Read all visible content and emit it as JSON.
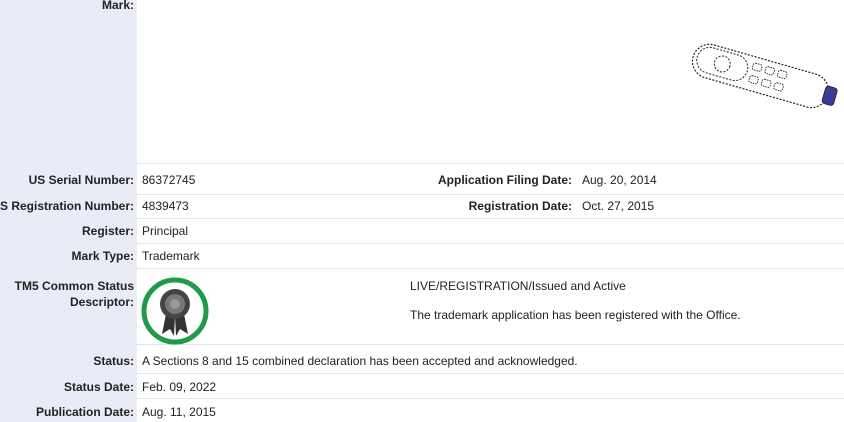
{
  "mark": {
    "label": "Mark:",
    "icon": "mark-drawing-remote"
  },
  "serial": {
    "label": "US Serial Number:",
    "value": "86372745"
  },
  "filing": {
    "label": "Application Filing Date:",
    "value": "Aug. 20, 2014"
  },
  "registration_number": {
    "label": "US Registration Number:",
    "value": "4839473"
  },
  "registration_date": {
    "label": "Registration Date:",
    "value": "Oct. 27, 2015"
  },
  "register": {
    "label": "Register:",
    "value": "Principal"
  },
  "mark_type": {
    "label": "Mark Type:",
    "value": "Trademark"
  },
  "tm5": {
    "label_line1": "TM5 Common Status",
    "label_line2": "Descriptor:",
    "status_code": "LIVE/REGISTRATION/Issued and Active",
    "status_desc": "The trademark application has been registered with the Office.",
    "badge_color": "#1f9a48"
  },
  "status": {
    "label": "Status:",
    "value": "A Sections 8 and 15 combined declaration has been accepted and acknowledged."
  },
  "status_date": {
    "label": "Status Date:",
    "value": "Feb. 09, 2022"
  },
  "publication_date": {
    "label": "Publication Date:",
    "value": "Aug. 11, 2015"
  }
}
